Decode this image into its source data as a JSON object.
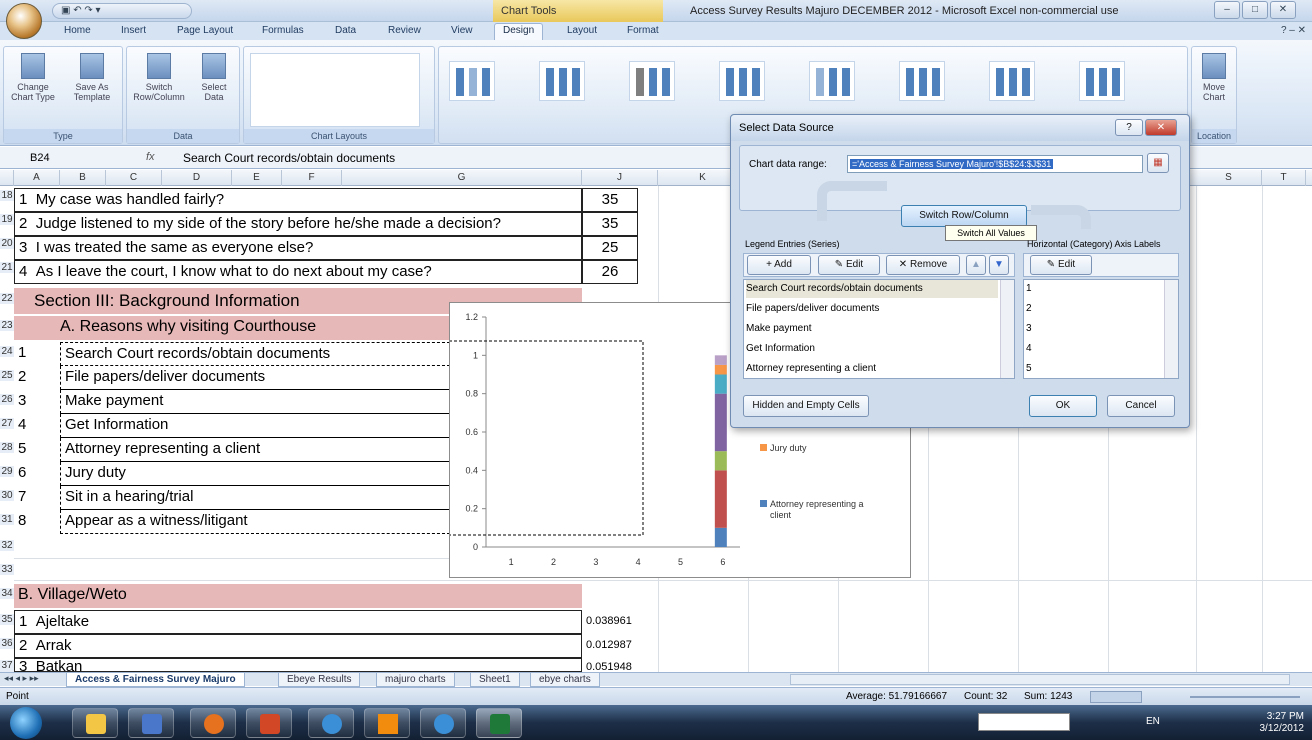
{
  "titlebar": {
    "qat": "▣ ↶ ↷ ▾",
    "chart_tools": "Chart Tools",
    "window_title": "Access Survey Results Majuro DECEMBER 2012 - Microsoft Excel non-commercial use",
    "min": "–",
    "max": "□",
    "close": "✕"
  },
  "ribbon_tabs": [
    "Home",
    "Insert",
    "Page Layout",
    "Formulas",
    "Data",
    "Review",
    "View",
    "Design",
    "Layout",
    "Format"
  ],
  "ribbon_right": "? – ✕",
  "ribbon": {
    "change_chart_type": "Change Chart Type",
    "save_as_template": "Save As Template",
    "group_type": "Type",
    "switch_row_column": "Switch Row/Column",
    "select_data": "Select Data",
    "group_data": "Data",
    "group_chart_layouts": "Chart Layouts",
    "move_chart": "Move Chart",
    "group_location": "Location"
  },
  "formula_bar": {
    "name_box": "B24",
    "fx": "fx",
    "formula": "Search Court records/obtain documents"
  },
  "columns": [
    "A",
    "B",
    "C",
    "D",
    "E",
    "F",
    "G",
    "J",
    "K",
    "S",
    "T"
  ],
  "rows": [
    {
      "num": "18",
      "a": "1",
      "b": "My case was handled fairly?",
      "j": "35"
    },
    {
      "num": "19",
      "a": "2",
      "b": "Judge listened to my side of the story before he/she made a decision?",
      "j": "35"
    },
    {
      "num": "20",
      "a": "3",
      "b": "I was treated the same as everyone else?",
      "j": "25"
    },
    {
      "num": "21",
      "a": "4",
      "b": "As I leave the court, I know what to do next about my case?",
      "j": "26"
    }
  ],
  "section3": {
    "num": "22",
    "text": "Section III:  Background Information"
  },
  "sectionA": {
    "num": "23",
    "text": "A. Reasons why visiting Courthouse"
  },
  "reasons": [
    {
      "num": "24",
      "a": "1",
      "b": "Search Court records/obtain documents"
    },
    {
      "num": "25",
      "a": "2",
      "b": "File papers/deliver documents"
    },
    {
      "num": "26",
      "a": "3",
      "b": "Make payment"
    },
    {
      "num": "27",
      "a": "4",
      "b": "Get Information"
    },
    {
      "num": "28",
      "a": "5",
      "b": "Attorney representing a client"
    },
    {
      "num": "29",
      "a": "6",
      "b": "Jury duty"
    },
    {
      "num": "30",
      "a": "7",
      "b": "Sit in a hearing/trial"
    },
    {
      "num": "31",
      "a": "8",
      "b": "Appear as a witness/litigant"
    }
  ],
  "empty_rows": [
    "32",
    "33"
  ],
  "sectionB": {
    "num": "34",
    "text": "B. Village/Weto"
  },
  "villages": [
    {
      "num": "35",
      "a": "1",
      "b": "Ajeltake",
      "j": "0.038961"
    },
    {
      "num": "36",
      "a": "2",
      "b": "Arrak",
      "j": "0.012987"
    },
    {
      "num": "37",
      "a": "3",
      "b": "Batkan",
      "j": "0.051948"
    }
  ],
  "chart_data": {
    "type": "bar",
    "stacked": true,
    "categories": [
      "1",
      "2",
      "3",
      "4",
      "5",
      "6"
    ],
    "ylim": [
      0,
      1.2
    ],
    "yticks": [
      "0",
      "0.2",
      "0.4",
      "0.6",
      "0.8",
      "1",
      "1.2"
    ],
    "series": [
      {
        "name": "Attorney representing a client",
        "color": "#4f81bd",
        "values": [
          0,
          0,
          0,
          0,
          0,
          0.1
        ]
      },
      {
        "name": "",
        "color": "#c0504d",
        "values": [
          0,
          0,
          0,
          0,
          0,
          0.3
        ]
      },
      {
        "name": "",
        "color": "#9bbb59",
        "values": [
          0,
          0,
          0,
          0,
          0,
          0.1
        ]
      },
      {
        "name": "",
        "color": "#8064a2",
        "values": [
          0,
          0,
          0,
          0,
          0,
          0.3
        ]
      },
      {
        "name": "",
        "color": "#4bacc6",
        "values": [
          0,
          0,
          0,
          0,
          0,
          0.1
        ]
      },
      {
        "name": "Jury duty",
        "color": "#f79646",
        "values": [
          0,
          0,
          0,
          0,
          0,
          0.05
        ]
      },
      {
        "name": "",
        "color": "#b9a0c7",
        "values": [
          0,
          0,
          0,
          0,
          0,
          0.05
        ]
      }
    ],
    "legend_visible": [
      "Jury duty",
      "Attorney representing a client"
    ]
  },
  "dialog": {
    "title": "Select Data Source",
    "help": "?",
    "close": "✕",
    "chart_range_label": "Chart data range:",
    "chart_range_value": "='Access & Fairness Survey Majuro'!$B$24:$J$31",
    "switch_button": "Switch Row/Column",
    "tooltip": "Switch All Values",
    "legend_label": "Legend Entries (Series)",
    "axis_label": "Horizontal (Category) Axis Labels",
    "add": "Add",
    "edit": "Edit",
    "remove": "Remove",
    "axis_edit": "Edit",
    "series": [
      "Search Court records/obtain documents",
      "File papers/deliver documents",
      "Make payment",
      "Get Information",
      "Attorney representing a client"
    ],
    "axis_items": [
      "1",
      "2",
      "3",
      "4",
      "5"
    ],
    "hidden_cells": "Hidden and Empty Cells",
    "ok": "OK",
    "cancel": "Cancel"
  },
  "sheet_tabs": [
    "Access & Fairness Survey Majuro",
    "Ebeye Results",
    "majuro charts",
    "Sheet1",
    "ebye charts"
  ],
  "status": {
    "mode": "Point",
    "average": "Average: 51.79166667",
    "count": "Count: 32",
    "sum": "Sum: 1243"
  },
  "taskbar": {
    "lang": "EN",
    "time": "3:27 PM",
    "date": "3/12/2012"
  },
  "colors": {
    "section_fill": "#e6b8b7",
    "chart_tools": "#e9c85a",
    "ribbon": "#dbe7f5"
  }
}
